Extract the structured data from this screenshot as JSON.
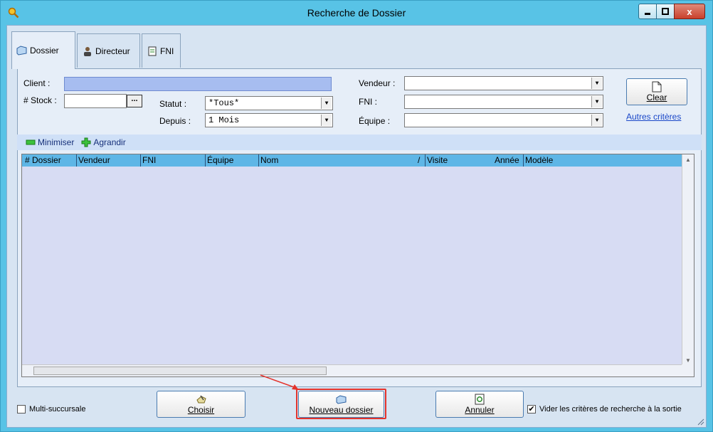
{
  "window": {
    "title": "Recherche de Dossier",
    "close_label": "x"
  },
  "tabs": [
    {
      "label": "Dossier"
    },
    {
      "label": "Directeur"
    },
    {
      "label": "FNI"
    }
  ],
  "filters": {
    "client_label": "Client :",
    "client_value": "",
    "stock_label": "# Stock :",
    "stock_value": "",
    "stock_browse_label": "...",
    "statut_label": "Statut :",
    "statut_value": "*Tous*",
    "depuis_label": "Depuis :",
    "depuis_value": "1 Mois",
    "vendeur_label": "Vendeur :",
    "vendeur_value": "",
    "fni_label": "FNI :",
    "fni_value": "",
    "equipe_label": "Équipe :",
    "equipe_value": "",
    "clear_label": "Clear",
    "autres_criteres_label": "Autres critères"
  },
  "toolbar": {
    "minimiser_label": "Minimiser",
    "agrandir_label": "Agrandir"
  },
  "grid": {
    "columns": [
      "# Dossier",
      "Vendeur",
      "FNI",
      "Équipe",
      "Nom",
      "/",
      "Visite",
      "Année",
      "Modèle"
    ],
    "rows": []
  },
  "footer": {
    "multi_succursale_label": "Multi-succursale",
    "multi_succursale_checked": false,
    "choisir_label": "Choisir",
    "nouveau_label": "Nouveau dossier",
    "annuler_label": "Annuler",
    "vider_label": "Vider les critères de recherche à la sortie",
    "vider_checked": true
  },
  "colors": {
    "titlebar": "#58c3e6",
    "client_bg": "#d7e4f2",
    "grid_header": "#5eb6e6",
    "highlight_frame": "#e4332c"
  }
}
